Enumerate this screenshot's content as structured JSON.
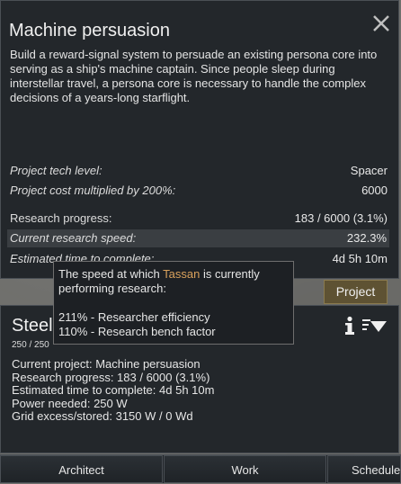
{
  "research": {
    "title": "Machine persuasion",
    "description": "Build a reward-signal system to persuade an existing persona core into serving as a ship's machine captain. Since people sleep during interstellar travel, a persona core is necessary to handle the complex decisions of a years-long starflight.",
    "tech_level_label": "Project tech level:",
    "tech_level_value": "Spacer",
    "cost_label": "Project cost multiplied by 200%:",
    "cost_value": "6000",
    "progress_label": "Research progress:",
    "progress_value": "183 / 6000 (3.1%)",
    "speed_label": "Current research speed:",
    "speed_value": "232.3%",
    "eta_label": "Estimated time to complete:",
    "eta_value": "4d 5h 10m",
    "project_button": "Project"
  },
  "tooltip": {
    "line1_before": "The speed at which ",
    "researcher": "Tassan",
    "line1_after": " is currently",
    "line2": "performing research:",
    "factor1": "211% - Researcher efficiency",
    "factor2": "110% - Research bench factor"
  },
  "bench": {
    "title": "Steel",
    "hp": "250 / 250",
    "current_project": "Current project: Machine persuasion",
    "progress": "Research progress: 183 / 6000 (3.1%)",
    "eta": "Estimated time to complete: 4d 5h 10m",
    "power": "Power needed: 250 W",
    "grid": "Grid excess/stored: 3150 W / 0 Wd"
  },
  "bottom_tabs": [
    "Architect",
    "Work",
    "Schedule"
  ],
  "colors": {
    "accent": "#d9a15c",
    "button": "#5e5233"
  }
}
